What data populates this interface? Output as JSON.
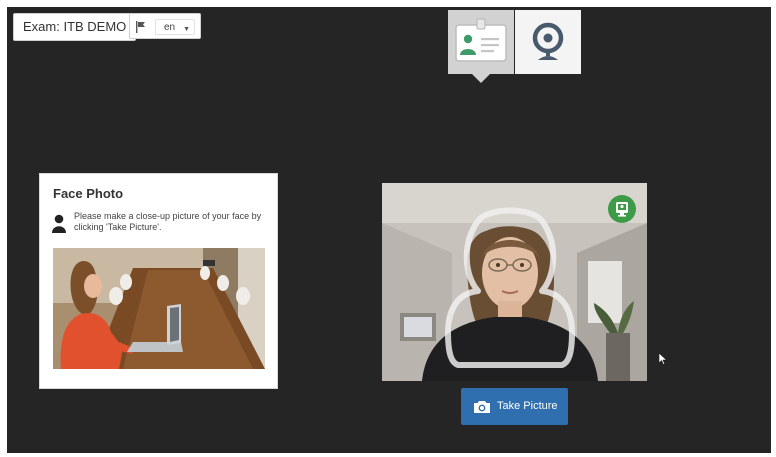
{
  "header": {
    "exam_label": "Exam: ITB DEMO",
    "language": {
      "flag_icon": "flag-icon",
      "selected": "en"
    }
  },
  "steps": [
    {
      "name": "id-card-step",
      "icon": "id-card-icon",
      "active": true
    },
    {
      "name": "webcam-step",
      "icon": "webcam-icon",
      "active": false
    }
  ],
  "face_photo": {
    "title": "Face Photo",
    "icon": "person-icon",
    "instructions": "Please make a close-up picture of your face by clicking 'Take Picture'."
  },
  "webcam": {
    "indicator_icon": "id-monitor-icon",
    "indicator_color": "#3d9a47"
  },
  "actions": {
    "take_picture_label": "Take Picture",
    "take_picture_icon": "camera-icon",
    "button_color": "#2f6fb0"
  },
  "colors": {
    "background": "#252525",
    "panel": "#ffffff"
  }
}
